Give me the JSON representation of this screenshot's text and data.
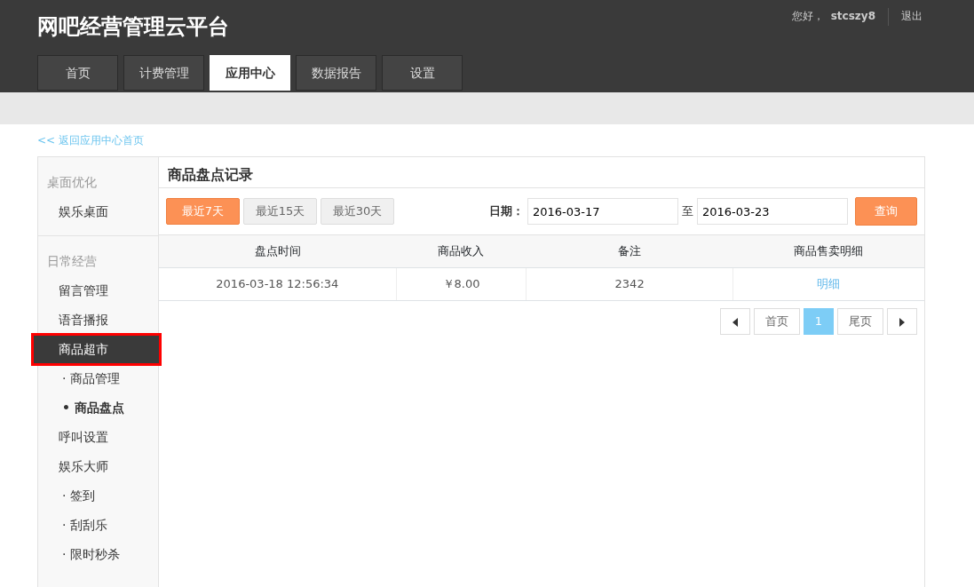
{
  "header": {
    "title": "网吧经营管理云平台",
    "greeting": "您好，",
    "username": "stcszy8",
    "logout": "退出"
  },
  "tabs": [
    {
      "label": "首页",
      "selected": false
    },
    {
      "label": "计费管理",
      "selected": false
    },
    {
      "label": "应用中心",
      "selected": true
    },
    {
      "label": "数据报告",
      "selected": false
    },
    {
      "label": "设置",
      "selected": false
    }
  ],
  "back_link": "<< 返回应用中心首页",
  "sidebar": {
    "groups": [
      {
        "title": "桌面优化",
        "items": [
          {
            "label": "娱乐桌面",
            "selected": false,
            "highlighted": false
          }
        ]
      },
      {
        "title": "日常经营",
        "items": [
          {
            "label": "留言管理",
            "selected": false,
            "highlighted": false
          },
          {
            "label": "语音播报",
            "selected": false,
            "highlighted": false
          },
          {
            "label": "商品超市",
            "selected": true,
            "highlighted": true,
            "children": [
              {
                "bullet": "·",
                "label": "商品管理",
                "selected": false
              },
              {
                "bullet": "•",
                "label": "商品盘点",
                "selected": true
              }
            ]
          },
          {
            "label": "呼叫设置",
            "selected": false,
            "highlighted": false
          },
          {
            "label": "娱乐大师",
            "selected": false,
            "highlighted": false,
            "children": [
              {
                "bullet": "·",
                "label": "签到",
                "selected": false
              },
              {
                "bullet": "·",
                "label": "刮刮乐",
                "selected": false
              },
              {
                "bullet": "·",
                "label": "限时秒杀",
                "selected": false
              }
            ]
          }
        ]
      }
    ]
  },
  "panel": {
    "title": "商品盘点记录",
    "ranges": [
      {
        "label": "最近7天",
        "selected": true
      },
      {
        "label": "最近15天",
        "selected": false
      },
      {
        "label": "最近30天",
        "selected": false
      }
    ],
    "date_label": "日期：",
    "date_from": "2016-03-17",
    "date_sep": "至",
    "date_to": "2016-03-23",
    "query_button": "查询",
    "table": {
      "columns": [
        "盘点时间",
        "商品收入",
        "备注",
        "商品售卖明细"
      ],
      "rows": [
        {
          "time": "2016-03-18 12:56:34",
          "income": "￥8.00",
          "note": "2342",
          "detail_link": "明细"
        }
      ]
    },
    "pagination": {
      "first": "首页",
      "pages": [
        {
          "label": "1",
          "selected": true
        }
      ],
      "last": "尾页"
    }
  }
}
